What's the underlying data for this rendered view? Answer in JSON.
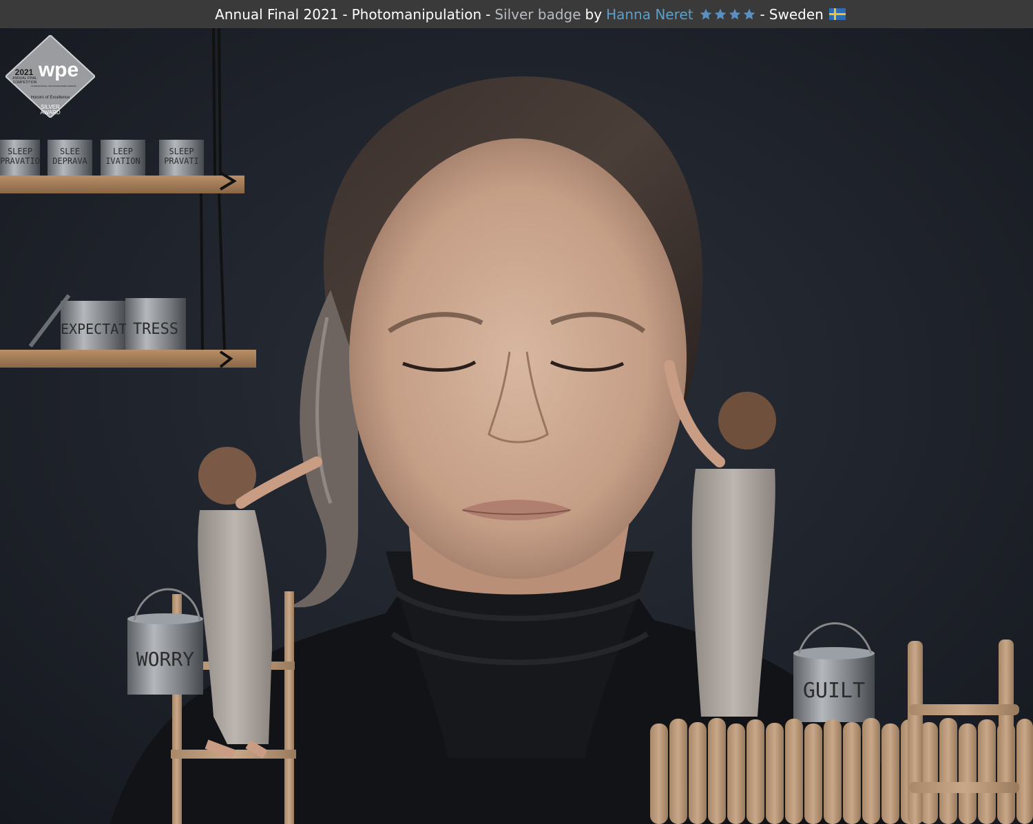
{
  "header": {
    "contest": "Annual Final 2021",
    "category": "Photomanipulation",
    "badge": "Silver badge",
    "by": "by",
    "author": "Hanna Neret",
    "rating_stars": 4,
    "country": "Sweden",
    "separator": "-",
    "colors": {
      "bar": "#3a3a3b",
      "author_link": "#5aa0c8",
      "badge_text": "#b9bcc0",
      "star": "#5a8fc0"
    },
    "icons": [
      "star-icon",
      "sweden-flag-icon"
    ]
  },
  "award_badge": {
    "year": "2021",
    "logo": "wpe",
    "line1": "ANNUAL FINAL",
    "line2": "COMPETITION",
    "org": "INTERNATIONAL PHOTOGRAPHERS AWARDS",
    "honors": "Honors of Excellence",
    "award_line1": "SILVER",
    "award_line2": "AWARD"
  },
  "paint_cans": {
    "top_shelf": [
      {
        "line1": "SLEEP",
        "line2": "PRAVATIO"
      },
      {
        "line1": "SLEE",
        "line2": "DEPRAVA"
      },
      {
        "line1": "LEEP",
        "line2": "IVATION"
      },
      {
        "line1": "SLEEP",
        "line2": "PRAVATI"
      }
    ],
    "middle_shelf": [
      {
        "label": "EXPECTAT"
      },
      {
        "label": "TRESS"
      }
    ],
    "floor": [
      {
        "label": "WORRY"
      },
      {
        "label": "GUILT"
      }
    ]
  }
}
